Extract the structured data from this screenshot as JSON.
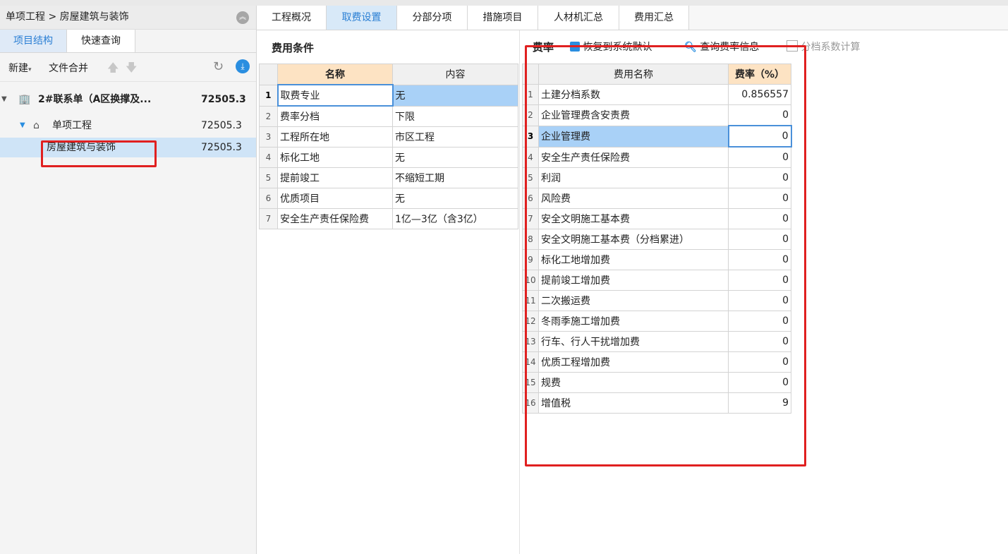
{
  "left": {
    "breadcrumb": "单项工程 > 房屋建筑与装饰",
    "tabs": [
      "项目结构",
      "快速查询"
    ],
    "toolbar": {
      "new": "新建",
      "merge": "文件合并"
    },
    "tree": [
      {
        "label": "2#联系单（A区换撑及...",
        "value": "72505.3"
      },
      {
        "label": "单项工程",
        "value": "72505.3"
      },
      {
        "label": "房屋建筑与装饰",
        "value": "72505.3"
      }
    ]
  },
  "tabs": [
    "工程概况",
    "取费设置",
    "分部分项",
    "措施项目",
    "人材机汇总",
    "费用汇总"
  ],
  "conditions": {
    "title": "费用条件",
    "headers": [
      "名称",
      "内容"
    ],
    "rows": [
      {
        "n": "1",
        "name": "取费专业",
        "content": "无"
      },
      {
        "n": "2",
        "name": "费率分档",
        "content": "下限"
      },
      {
        "n": "3",
        "name": "工程所在地",
        "content": "市区工程"
      },
      {
        "n": "4",
        "name": "标化工地",
        "content": "无"
      },
      {
        "n": "5",
        "name": "提前竣工",
        "content": "不缩短工期"
      },
      {
        "n": "6",
        "name": "优质项目",
        "content": "无"
      },
      {
        "n": "7",
        "name": "安全生产责任保险费",
        "content": "1亿—3亿（含3亿）"
      }
    ]
  },
  "rates": {
    "title": "费率",
    "restore": "恢复到系统默认",
    "query": "查询费率信息",
    "tiered": "分档系数计算",
    "headers": [
      "费用名称",
      "费率（%）"
    ],
    "rows": [
      {
        "n": "1",
        "name": "土建分档系数",
        "rate": "0.856557"
      },
      {
        "n": "2",
        "name": "企业管理费含安责费",
        "rate": "0"
      },
      {
        "n": "3",
        "name": "企业管理费",
        "rate": "0"
      },
      {
        "n": "4",
        "name": "安全生产责任保险费",
        "rate": "0"
      },
      {
        "n": "5",
        "name": "利润",
        "rate": "0"
      },
      {
        "n": "6",
        "name": "风险费",
        "rate": "0"
      },
      {
        "n": "7",
        "name": "安全文明施工基本费",
        "rate": "0"
      },
      {
        "n": "8",
        "name": "安全文明施工基本费（分档累进）",
        "rate": "0"
      },
      {
        "n": "9",
        "name": "标化工地增加费",
        "rate": "0"
      },
      {
        "n": "10",
        "name": "提前竣工增加费",
        "rate": "0"
      },
      {
        "n": "11",
        "name": "二次搬运费",
        "rate": "0"
      },
      {
        "n": "12",
        "name": "冬雨季施工增加费",
        "rate": "0"
      },
      {
        "n": "13",
        "name": "行车、行人干扰增加费",
        "rate": "0"
      },
      {
        "n": "14",
        "name": "优质工程增加费",
        "rate": "0"
      },
      {
        "n": "15",
        "name": "规费",
        "rate": "0"
      },
      {
        "n": "16",
        "name": "增值税",
        "rate": "9"
      }
    ]
  },
  "colors": {
    "accent": "#2a7fd4",
    "highlight": "#e02020",
    "selected": "#a9d1f7"
  }
}
